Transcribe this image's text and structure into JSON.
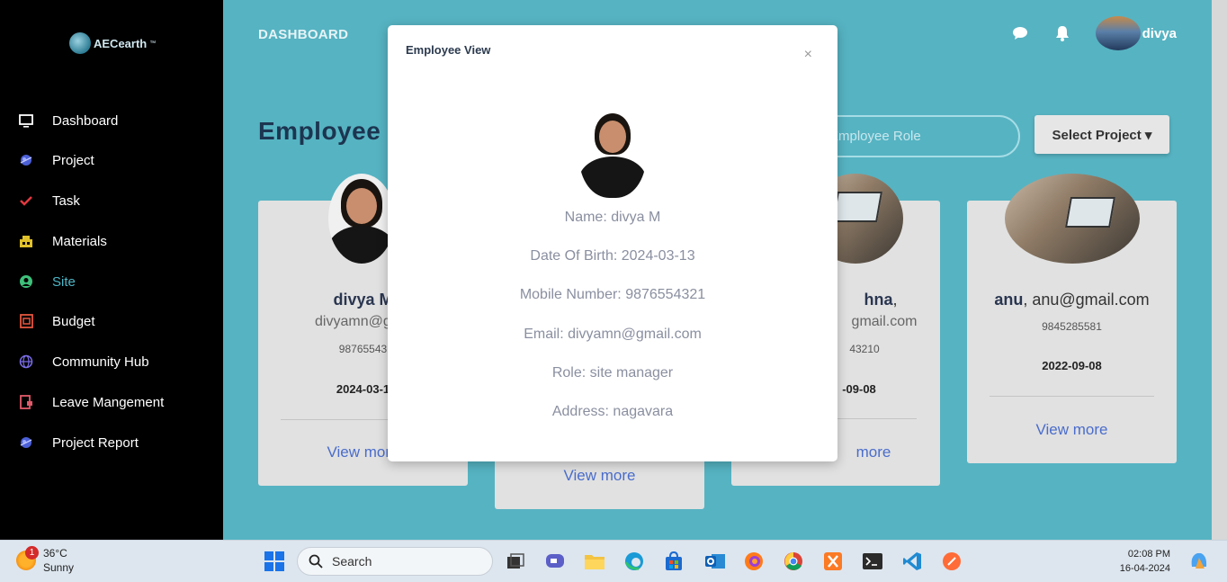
{
  "sidebar": {
    "logo_text": "AECearth",
    "logo_tm": "™",
    "items": [
      {
        "label": "Dashboard",
        "icon": "monitor-icon",
        "color": "#ffffff"
      },
      {
        "label": "Project",
        "icon": "project-icon",
        "color": "#5b6ee8"
      },
      {
        "label": "Task",
        "icon": "check-icon",
        "color": "#e2383f"
      },
      {
        "label": "Materials",
        "icon": "materials-icon",
        "color": "#e0c12a"
      },
      {
        "label": "Site",
        "icon": "user-circle-icon",
        "color": "#3ec07a"
      },
      {
        "label": "Budget",
        "icon": "budget-icon",
        "color": "#e2563f"
      },
      {
        "label": "Community Hub",
        "icon": "globe-icon",
        "color": "#7b6ee8"
      },
      {
        "label": "Leave Mangement",
        "icon": "leave-icon",
        "color": "#e05a6a"
      },
      {
        "label": "Project Report",
        "icon": "report-icon",
        "color": "#5b6ee8"
      }
    ]
  },
  "topbar": {
    "title": "DASHBOARD",
    "user_name": "divya"
  },
  "main": {
    "heading": "Employee D",
    "role_placeholder": "Employee Role",
    "project_button": "Select Project ▾"
  },
  "cards": [
    {
      "name": "divya M",
      "email": "divyamn@gma",
      "phone": "98765543",
      "date": "2024-03-1",
      "more": "View more"
    },
    {
      "name": "",
      "email": "",
      "phone": "",
      "date": "",
      "more": "View more"
    },
    {
      "name": "hna",
      "name_suffix": ",",
      "email": "gmail.com",
      "phone": "43210",
      "date": "-09-08",
      "more": "more"
    },
    {
      "name": "anu",
      "name_suffix": ", anu@gmail.com",
      "email": "",
      "phone": "9845285581",
      "date": "2022-09-08",
      "more": "View more"
    }
  ],
  "modal": {
    "title": "Employee View",
    "close": "×",
    "name_line": "Name: divya M",
    "dob_line": "Date Of Birth: 2024-03-13",
    "mobile_line": "Mobile Number: 9876554321",
    "email_line": "Email: divyamn@gmail.com",
    "role_line": "Role: site manager",
    "address_line": "Address: nagavara"
  },
  "taskbar": {
    "weather_temp": "36°C",
    "weather_desc": "Sunny",
    "weather_badge": "1",
    "search_label": "Search",
    "time": "02:08 PM",
    "date": "16-04-2024"
  }
}
